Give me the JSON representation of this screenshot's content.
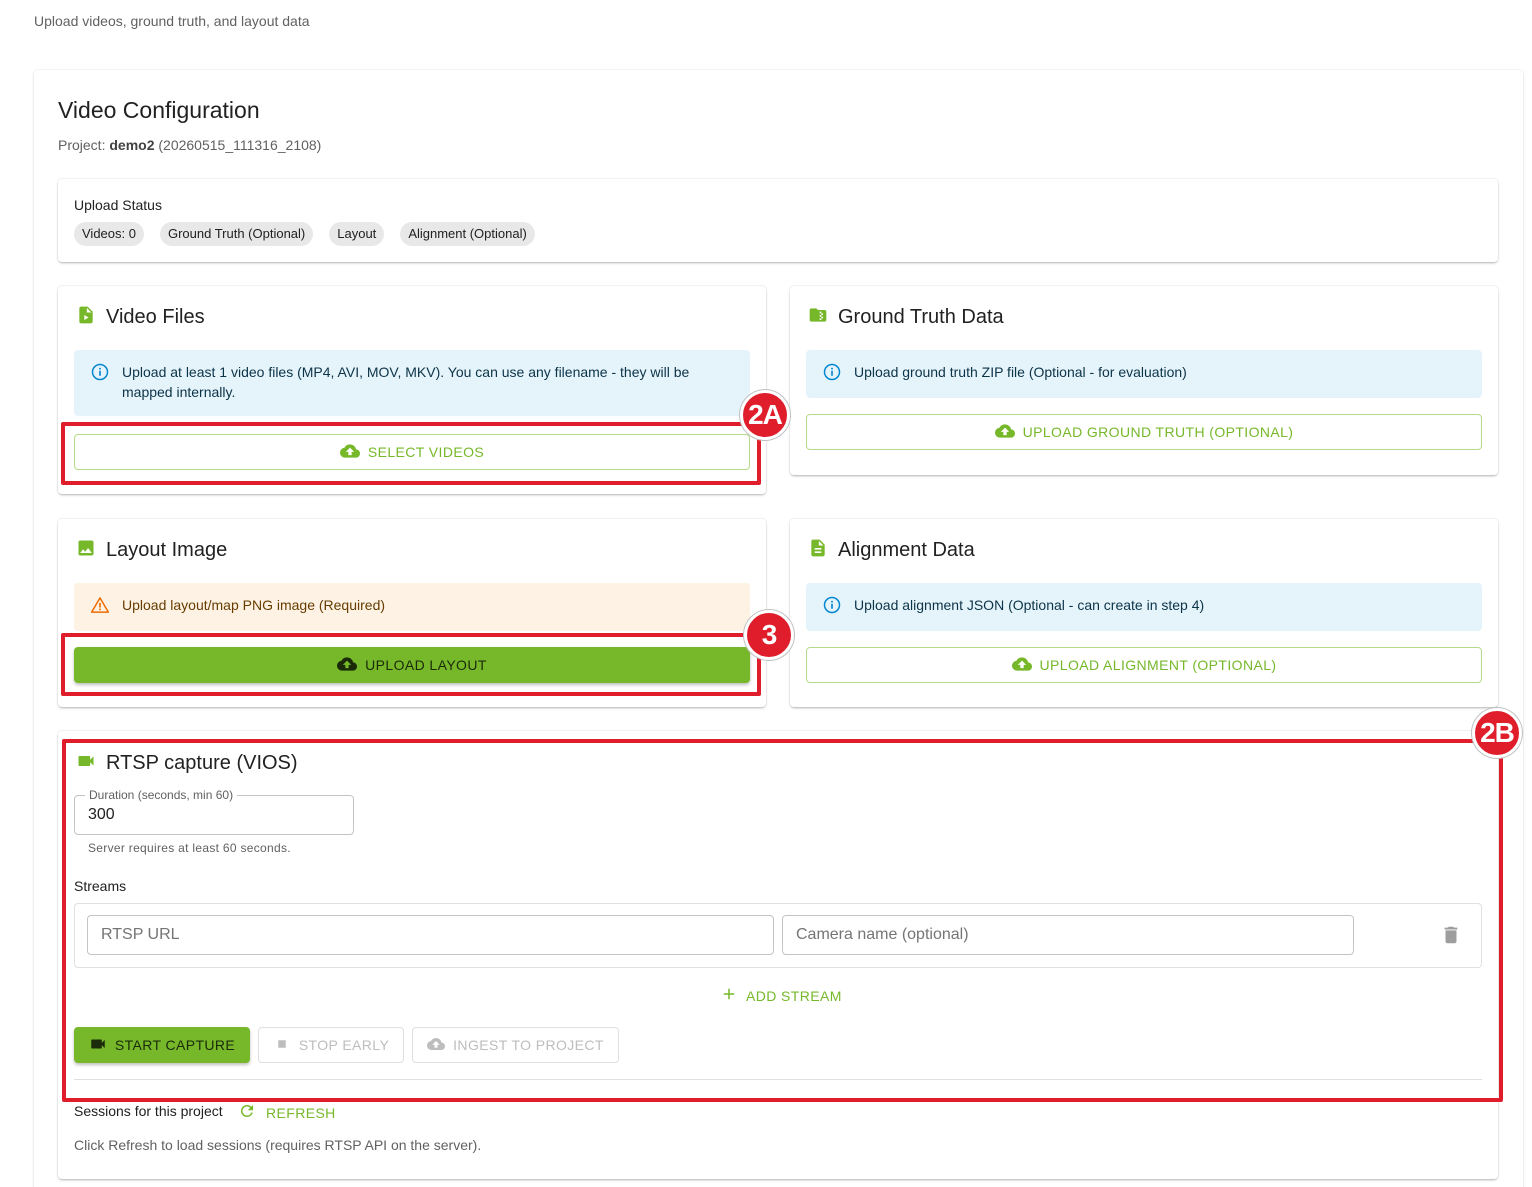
{
  "header": {
    "subtitle": "Upload videos, ground truth, and layout data"
  },
  "page": {
    "title": "Video Configuration",
    "project_prefix": "Project:",
    "project_name": "demo2",
    "project_id": "(20260515_111316_2108)"
  },
  "upload_status": {
    "label": "Upload Status",
    "chips": [
      "Videos: 0",
      "Ground Truth (Optional)",
      "Layout",
      "Alignment (Optional)"
    ]
  },
  "video_files": {
    "title": "Video Files",
    "icon": "video-file-icon",
    "alert": "Upload at least 1 video files (MP4, AVI, MOV, MKV). You can use any filename - they will be mapped internally.",
    "button": "SELECT VIDEOS"
  },
  "ground_truth": {
    "title": "Ground Truth Data",
    "icon": "folder-icon",
    "alert": "Upload ground truth ZIP file (Optional - for evaluation)",
    "button": "UPLOAD GROUND TRUTH (OPTIONAL)"
  },
  "layout_image": {
    "title": "Layout Image",
    "icon": "image-icon",
    "alert": "Upload layout/map PNG image (Required)",
    "button": "UPLOAD LAYOUT"
  },
  "alignment": {
    "title": "Alignment Data",
    "icon": "document-icon",
    "alert": "Upload alignment JSON (Optional - can create in step 4)",
    "button": "UPLOAD ALIGNMENT (OPTIONAL)"
  },
  "rtsp": {
    "title": "RTSP capture (VIOS)",
    "icon": "videocam-icon",
    "duration_label": "Duration (seconds, min 60)",
    "duration_value": "300",
    "duration_helper": "Server requires at least 60 seconds.",
    "streams_label": "Streams",
    "rtsp_url_placeholder": "RTSP URL",
    "camera_name_placeholder": "Camera name (optional)",
    "add_stream": "ADD STREAM",
    "start_capture": "START CAPTURE",
    "stop_early": "STOP EARLY",
    "ingest": "INGEST TO PROJECT",
    "sessions_label": "Sessions for this project",
    "refresh": "REFRESH",
    "sessions_note": "Click Refresh to load sessions (requires RTSP API on the server)."
  },
  "annotations": {
    "badge_2a": "2A",
    "badge_3": "3",
    "badge_2b": "2B"
  },
  "colors": {
    "accent": "#76b82a",
    "highlight": "#e01e2b",
    "info_bg": "#e5f4fb",
    "warn_bg": "#fdf2e3"
  }
}
